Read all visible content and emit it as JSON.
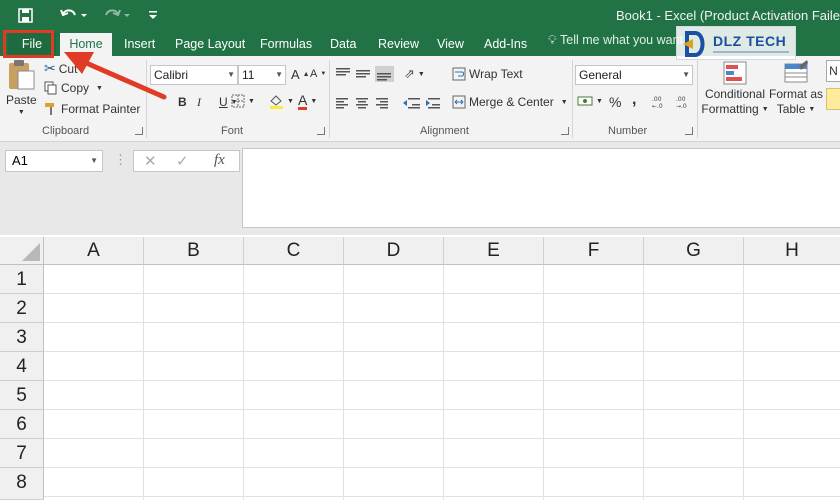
{
  "window": {
    "title": "Book1 - Excel (Product Activation Faile"
  },
  "tabs": [
    {
      "label": "File"
    },
    {
      "label": "Home"
    },
    {
      "label": "Insert"
    },
    {
      "label": "Page Layout"
    },
    {
      "label": "Formulas"
    },
    {
      "label": "Data"
    },
    {
      "label": "Review"
    },
    {
      "label": "View"
    },
    {
      "label": "Add-Ins"
    }
  ],
  "tell_me": "Tell me what you want",
  "watermark": {
    "text": "DLZ TECH"
  },
  "clipboard": {
    "paste": "Paste",
    "cut": "Cut",
    "copy": "Copy",
    "format_painter": "Format Painter",
    "label": "Clipboard"
  },
  "font": {
    "name": "Calibri",
    "size": "11",
    "bold": "B",
    "italic": "I",
    "underline": "U",
    "grow": "A",
    "shrink": "A",
    "font_color": "A",
    "label": "Font"
  },
  "alignment": {
    "wrap": "Wrap Text",
    "merge": "Merge & Center",
    "label": "Alignment"
  },
  "number": {
    "format": "General",
    "percent": "%",
    "comma": ",",
    "label": "Number"
  },
  "styles": {
    "conditional_1": "Conditional",
    "conditional_2": "Formatting",
    "format_as_1": "Format as",
    "format_as_2": "Table",
    "cell_style": "N"
  },
  "formula_bar": {
    "name_box": "A1",
    "fx": "fx"
  },
  "columns": [
    "A",
    "B",
    "C",
    "D",
    "E",
    "F",
    "G",
    "H"
  ],
  "rows": [
    "1",
    "2",
    "3",
    "4",
    "5",
    "6",
    "7",
    "8"
  ],
  "colors": {
    "excel_green": "#217346",
    "annotation_red": "#e03b24"
  }
}
